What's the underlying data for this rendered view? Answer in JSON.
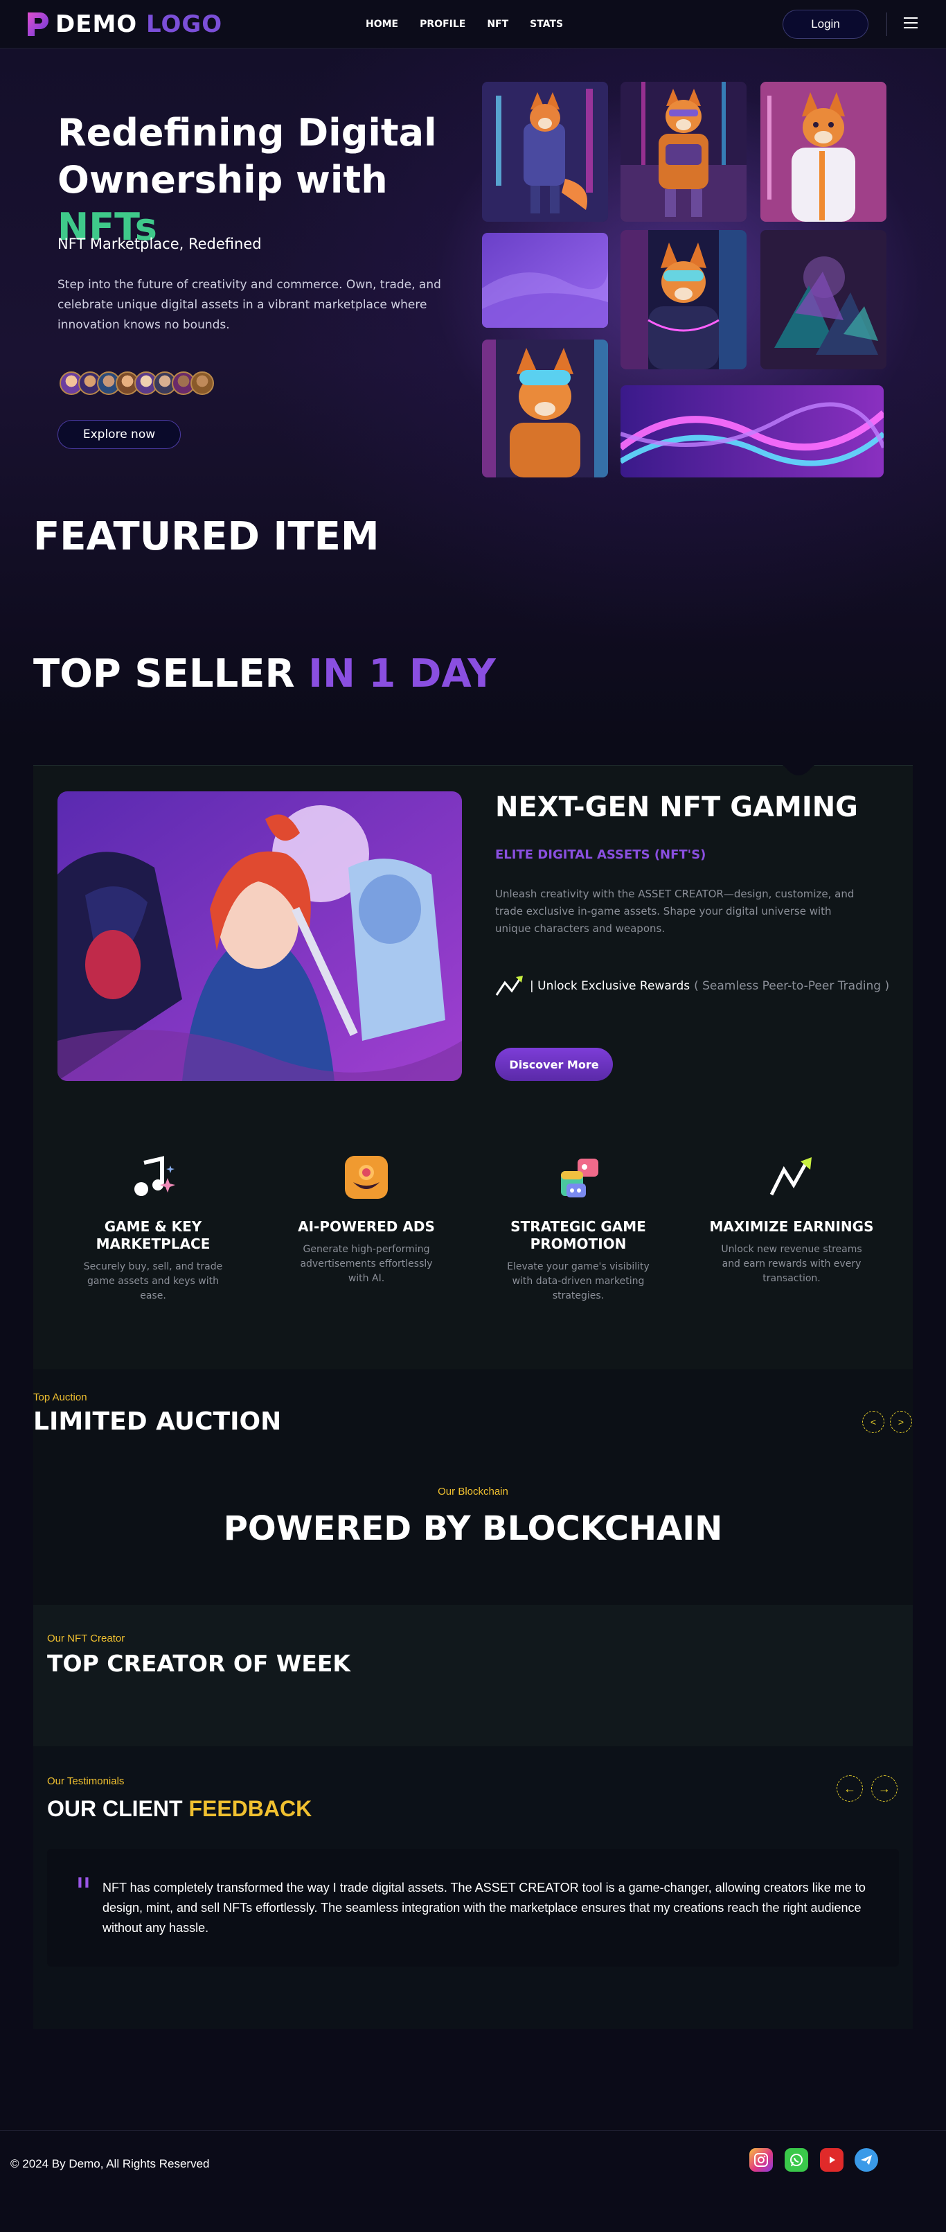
{
  "nav": {
    "logo_word1": "DEMO",
    "logo_word2": "LOGO",
    "links": [
      "HOME",
      "PROFILE",
      "NFT",
      "STATS"
    ],
    "login_label": "Login"
  },
  "hero": {
    "title_line1": "Redefining Digital",
    "title_line2_prefix": "Ownership with ",
    "title_accent": "NFTs",
    "subtitle": "NFT Marketplace, Redefined",
    "description": "Step into the future of creativity and commerce. Own, trade, and celebrate unique digital assets in a vibrant marketplace where innovation knows no bounds.",
    "explore_label": "Explore now"
  },
  "featured": {
    "heading": "FEATURED ITEM"
  },
  "top_seller": {
    "heading_main": "TOP SELLER ",
    "heading_accent": "IN 1 DAY"
  },
  "gaming": {
    "title": "NEXT-GEN NFT GAMING",
    "subtitle": "ELITE DIGITAL ASSETS (NFT'S)",
    "description": "Unleash creativity with the ASSET CREATOR—design, customize, and trade exclusive in-game assets. Shape your digital universe with unique characters and weapons.",
    "reward_main": "| Unlock Exclusive Rewards",
    "reward_note": "( Seamless Peer-to-Peer Trading )",
    "discover_label": "Discover More",
    "features": [
      {
        "icon": "music-note-icon",
        "title": "GAME & KEY MARKETPLACE",
        "desc": "Securely buy, sell, and trade game assets and keys with ease."
      },
      {
        "icon": "smiley-ad-icon",
        "title": "AI-POWERED ADS",
        "desc": "Generate high-performing advertisements effortlessly with AI."
      },
      {
        "icon": "colorful-apps-icon",
        "title": "STRATEGIC GAME PROMOTION",
        "desc": "Elevate your game's visibility with data-driven marketing strategies."
      },
      {
        "icon": "growth-arrow-icon",
        "title": "MAXIMIZE EARNINGS",
        "desc": "Unlock new revenue streams and earn rewards with every transaction."
      }
    ]
  },
  "auction": {
    "eyebrow": "Top Auction",
    "title": "LIMITED AUCTION",
    "prev": "<",
    "next": ">"
  },
  "blockchain": {
    "eyebrow": "Our Blockchain",
    "title": "POWERED BY BLOCKCHAIN"
  },
  "creator": {
    "eyebrow": "Our NFT Creator",
    "title": "TOP CREATOR OF WEEK"
  },
  "testimonials": {
    "eyebrow": "Our Testimonials",
    "title_main": "OUR CLIENT ",
    "title_accent": "FEEDBACK",
    "prev": "←",
    "next": "→",
    "quote_mark": "\"",
    "text": "NFT has completely transformed the way I trade digital assets. The ASSET CREATOR tool is a game-changer, allowing creators like me to design, mint, and sell NFTs effortlessly. The seamless integration with the marketplace ensures that my creations reach the right audience without any hassle."
  },
  "footer": {
    "copyright": "© 2024 By Demo, All Rights Reserved",
    "socials": [
      "instagram-icon",
      "whatsapp-icon",
      "youtube-icon",
      "telegram-icon"
    ]
  },
  "colors": {
    "accent_purple": "#8a4fe0",
    "accent_green": "#3fc98a",
    "accent_gold": "#f0c030",
    "background": "#0b0b18"
  }
}
